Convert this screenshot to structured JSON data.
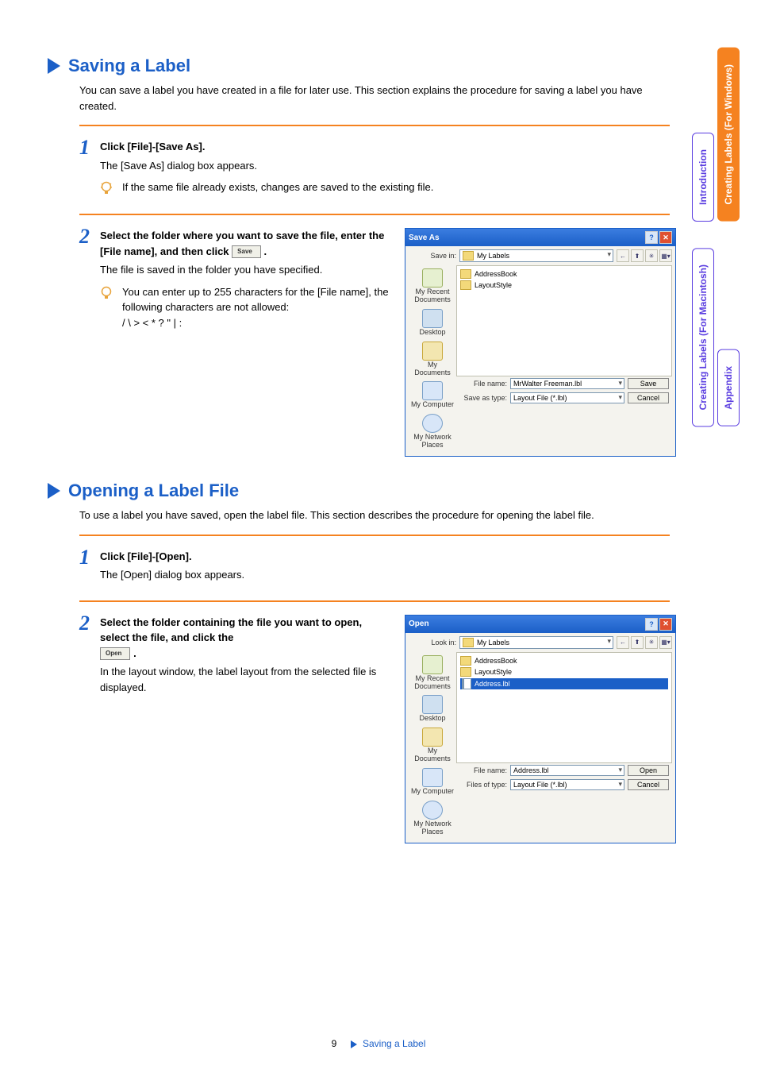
{
  "sidetabs": {
    "intro": "Introduction",
    "win": "Creating Labels (For Windows)",
    "mac": "Creating Labels (For Macintosh)",
    "appendix": "Appendix"
  },
  "section1": {
    "title": "Saving a Label",
    "intro": "You can save a label you have created in a file for later use. This section explains the procedure for saving a label you have created.",
    "step1": {
      "heading": "Click [File]-[Save As].",
      "desc": "The [Save As] dialog box appears.",
      "tip": "If the same file already exists, changes are saved to the existing file."
    },
    "step2": {
      "heading_a": "Select the folder where you want to save the file, enter the [File name], and then click ",
      "heading_b": ".",
      "btn": "Save",
      "desc": "The file is saved in the folder you have specified.",
      "tip_a": "You can enter up to 255 characters for the [File name], the following characters are not allowed:",
      "tip_b": "/ \\ > < * ? \" | :"
    }
  },
  "section2": {
    "title": "Opening a Label File",
    "intro": "To use a label you have saved, open the label file. This section describes the procedure for opening the label file.",
    "step1": {
      "heading": "Click [File]-[Open].",
      "desc": "The [Open] dialog box appears."
    },
    "step2": {
      "heading_a": "Select the folder containing the file you want to open, select the file, and click the ",
      "heading_b": ".",
      "btn": "Open",
      "desc": "In the layout window, the label layout from the selected file is displayed."
    }
  },
  "dialog_save": {
    "title": "Save As",
    "savein_label": "Save in:",
    "savein_value": "My Labels",
    "folders": {
      "a": "AddressBook",
      "b": "LayoutStyle"
    },
    "places": {
      "recent": "My Recent Documents",
      "desktop": "Desktop",
      "mydocs": "My Documents",
      "mycomp": "My Computer",
      "mynet": "My Network Places"
    },
    "filename_label": "File name:",
    "filename_value": "MrWalter Freeman.lbl",
    "type_label": "Save as type:",
    "type_value": "Layout File (*.lbl)",
    "btn_primary": "Save",
    "btn_cancel": "Cancel"
  },
  "dialog_open": {
    "title": "Open",
    "lookin_label": "Look in:",
    "lookin_value": "My Labels",
    "folders": {
      "a": "AddressBook",
      "b": "LayoutStyle",
      "c": "Address.lbl"
    },
    "filename_label": "File name:",
    "filename_value": "Address.lbl",
    "type_label": "Files of type:",
    "type_value": "Layout File (*.lbl)",
    "btn_primary": "Open",
    "btn_cancel": "Cancel"
  },
  "footer": {
    "page": "9",
    "crumb": "Saving a Label"
  }
}
